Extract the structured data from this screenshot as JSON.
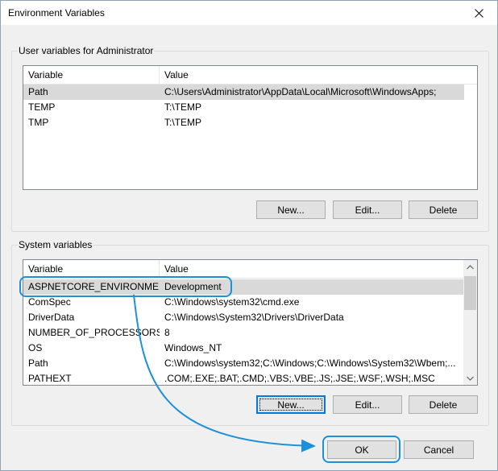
{
  "window": {
    "title": "Environment Variables"
  },
  "user_group": {
    "label": "User variables for Administrator",
    "columns": [
      "Variable",
      "Value"
    ],
    "rows": [
      {
        "variable": "Path",
        "value": "C:\\Users\\Administrator\\AppData\\Local\\Microsoft\\WindowsApps;"
      },
      {
        "variable": "TEMP",
        "value": "T:\\TEMP"
      },
      {
        "variable": "TMP",
        "value": "T:\\TEMP"
      }
    ],
    "buttons": {
      "new": "New...",
      "edit": "Edit...",
      "delete": "Delete"
    }
  },
  "system_group": {
    "label": "System variables",
    "columns": [
      "Variable",
      "Value"
    ],
    "rows": [
      {
        "variable": "ASPNETCORE_ENVIRONMENT",
        "value": "Development"
      },
      {
        "variable": "ComSpec",
        "value": "C:\\Windows\\system32\\cmd.exe"
      },
      {
        "variable": "DriverData",
        "value": "C:\\Windows\\System32\\Drivers\\DriverData"
      },
      {
        "variable": "NUMBER_OF_PROCESSORS",
        "value": "8"
      },
      {
        "variable": "OS",
        "value": "Windows_NT"
      },
      {
        "variable": "Path",
        "value": "C:\\Windows\\system32;C:\\Windows;C:\\Windows\\System32\\Wbem;..."
      },
      {
        "variable": "PATHEXT",
        "value": ".COM;.EXE;.BAT;.CMD;.VBS;.VBE;.JS;.JSE;.WSF;.WSH;.MSC"
      }
    ],
    "buttons": {
      "new": "New...",
      "edit": "Edit...",
      "delete": "Delete"
    }
  },
  "footer": {
    "ok": "OK",
    "cancel": "Cancel"
  },
  "colors": {
    "accent": "#0078d7",
    "annotation": "#1e90d8",
    "selection": "#d9d9d9"
  },
  "icons": [
    "close-icon",
    "scroll-up-icon",
    "scroll-down-icon"
  ]
}
